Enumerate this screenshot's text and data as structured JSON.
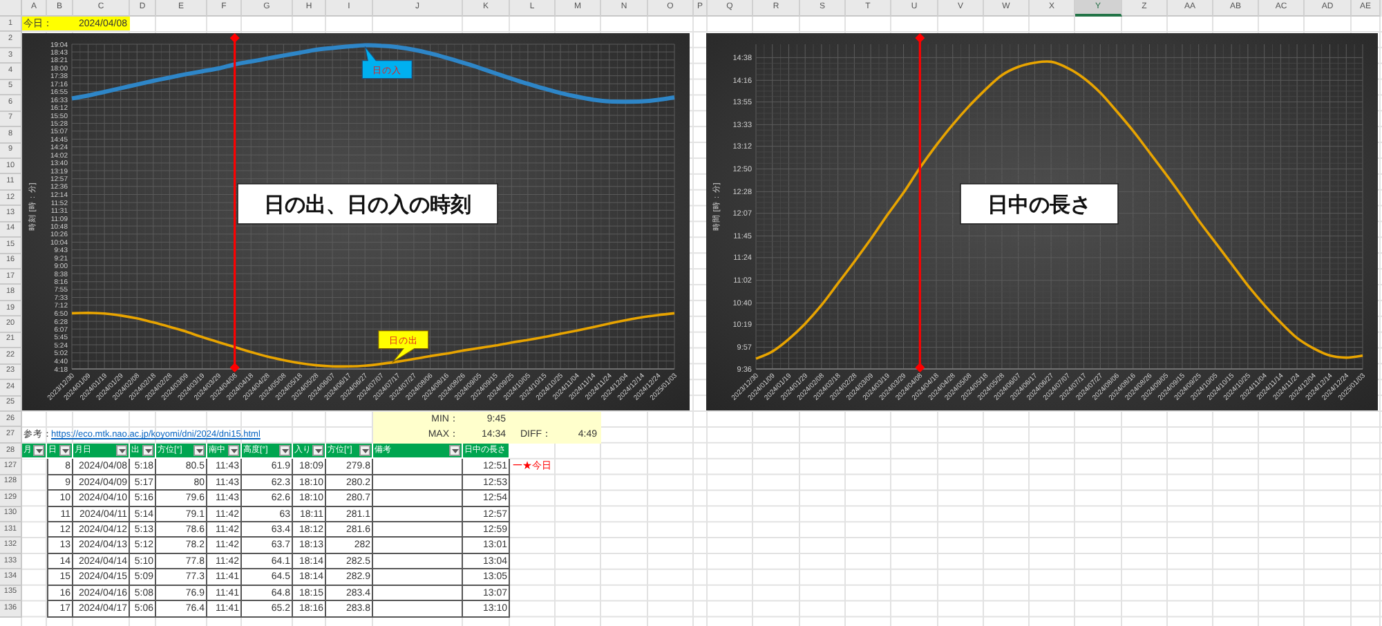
{
  "column_headers": [
    {
      "label": "A",
      "selected": false
    },
    {
      "label": "B",
      "selected": false
    },
    {
      "label": "C",
      "selected": false
    },
    {
      "label": "D",
      "selected": false
    },
    {
      "label": "E",
      "selected": false
    },
    {
      "label": "F",
      "selected": false
    },
    {
      "label": "G",
      "selected": false
    },
    {
      "label": "H",
      "selected": false
    },
    {
      "label": "I",
      "selected": false
    },
    {
      "label": "J",
      "selected": false
    },
    {
      "label": "K",
      "selected": false
    },
    {
      "label": "L",
      "selected": false
    },
    {
      "label": "M",
      "selected": false
    },
    {
      "label": "N",
      "selected": false
    },
    {
      "label": "O",
      "selected": false
    },
    {
      "label": "P",
      "selected": false
    },
    {
      "label": "Q",
      "selected": false
    },
    {
      "label": "R",
      "selected": false
    },
    {
      "label": "S",
      "selected": false
    },
    {
      "label": "T",
      "selected": false
    },
    {
      "label": "U",
      "selected": false
    },
    {
      "label": "V",
      "selected": false
    },
    {
      "label": "W",
      "selected": false
    },
    {
      "label": "X",
      "selected": false
    },
    {
      "label": "Y",
      "selected": true
    },
    {
      "label": "Z",
      "selected": false
    },
    {
      "label": "AA",
      "selected": false
    },
    {
      "label": "AB",
      "selected": false
    },
    {
      "label": "AC",
      "selected": false
    },
    {
      "label": "AD",
      "selected": false
    },
    {
      "label": "AE",
      "selected": false
    }
  ],
  "row_headers": [
    "1",
    "2",
    "3",
    "4",
    "5",
    "6",
    "7",
    "8",
    "9",
    "10",
    "11",
    "12",
    "13",
    "14",
    "15",
    "16",
    "17",
    "18",
    "19",
    "20",
    "21",
    "22",
    "23",
    "24",
    "25",
    "26",
    "27",
    "28",
    "127",
    "128",
    "129",
    "130",
    "131",
    "132",
    "133",
    "134",
    "135",
    "136"
  ],
  "today": {
    "label": "今日：",
    "date": "2024/04/08"
  },
  "charts": [
    {
      "chart_data": {
        "type": "line",
        "title": "日の出、日の入の時刻",
        "ylabel": "時刻 [時：分]",
        "categories": [
          "2023/12/30",
          "2024/01/09",
          "2024/01/19",
          "2024/01/29",
          "2024/02/08",
          "2024/02/18",
          "2024/02/28",
          "2024/03/09",
          "2024/03/19",
          "2024/03/29",
          "2024/04/08",
          "2024/04/18",
          "2024/04/28",
          "2024/05/08",
          "2024/05/18",
          "2024/05/28",
          "2024/06/07",
          "2024/06/17",
          "2024/06/27",
          "2024/07/07",
          "2024/07/17",
          "2024/07/27",
          "2024/08/06",
          "2024/08/16",
          "2024/08/26",
          "2024/09/05",
          "2024/09/15",
          "2024/09/25",
          "2024/10/05",
          "2024/10/15",
          "2024/10/25",
          "2024/11/04",
          "2024/11/14",
          "2024/11/24",
          "2024/12/04",
          "2024/12/14",
          "2024/12/24",
          "2025/01/03"
        ],
        "series": [
          {
            "name": "日の入",
            "color": "#2e86c8",
            "values": [
              996,
              1004,
              1014,
              1024,
              1034,
              1044,
              1053,
              1062,
              1070,
              1078,
              1089,
              1097,
              1105,
              1113,
              1121,
              1129,
              1134,
              1138,
              1141,
              1140,
              1136,
              1129,
              1119,
              1107,
              1094,
              1080,
              1065,
              1050,
              1036,
              1023,
              1011,
              1001,
              993,
              988,
              987,
              988,
              992,
              999
            ]
          },
          {
            "name": "日の出",
            "color": "#e8a400",
            "values": [
              410,
              411,
              409,
              404,
              396,
              385,
              373,
              360,
              345,
              331,
              318,
              304,
              292,
              282,
              274,
              268,
              265,
              265,
              267,
              272,
              278,
              285,
              293,
              300,
              308,
              315,
              322,
              330,
              337,
              345,
              354,
              363,
              372,
              382,
              391,
              399,
              405,
              410
            ]
          }
        ],
        "ylim": [
          258,
          1144
        ],
        "yticks": [
          {
            "value": 258,
            "label": "4:18"
          },
          {
            "value": 280,
            "label": "4:40"
          },
          {
            "value": 302,
            "label": "5:02"
          },
          {
            "value": 324,
            "label": "5:24"
          },
          {
            "value": 345,
            "label": "5:45"
          },
          {
            "value": 367,
            "label": "6:07"
          },
          {
            "value": 388,
            "label": "6:28"
          },
          {
            "value": 410,
            "label": "6:50"
          },
          {
            "value": 432,
            "label": "7:12"
          },
          {
            "value": 453,
            "label": "7:33"
          },
          {
            "value": 475,
            "label": "7:55"
          },
          {
            "value": 496,
            "label": "8:16"
          },
          {
            "value": 518,
            "label": "8:38"
          },
          {
            "value": 540,
            "label": "9:00"
          },
          {
            "value": 561,
            "label": "9:21"
          },
          {
            "value": 583,
            "label": "9:43"
          },
          {
            "value": 604,
            "label": "10:04"
          },
          {
            "value": 626,
            "label": "10:26"
          },
          {
            "value": 648,
            "label": "10:48"
          },
          {
            "value": 669,
            "label": "11:09"
          },
          {
            "value": 691,
            "label": "11:31"
          },
          {
            "value": 712,
            "label": "11:52"
          },
          {
            "value": 734,
            "label": "12:14"
          },
          {
            "value": 756,
            "label": "12:36"
          },
          {
            "value": 777,
            "label": "12:57"
          },
          {
            "value": 799,
            "label": "13:19"
          },
          {
            "value": 820,
            "label": "13:40"
          },
          {
            "value": 842,
            "label": "14:02"
          },
          {
            "value": 864,
            "label": "14:24"
          },
          {
            "value": 885,
            "label": "14:45"
          },
          {
            "value": 907,
            "label": "15:07"
          },
          {
            "value": 928,
            "label": "15:28"
          },
          {
            "value": 950,
            "label": "15:50"
          },
          {
            "value": 972,
            "label": "16:12"
          },
          {
            "value": 993,
            "label": "16:33"
          },
          {
            "value": 1015,
            "label": "16:55"
          },
          {
            "value": 1036,
            "label": "17:16"
          },
          {
            "value": 1058,
            "label": "17:38"
          },
          {
            "value": 1080,
            "label": "18:00"
          },
          {
            "value": 1101,
            "label": "18:21"
          },
          {
            "value": 1123,
            "label": "18:43"
          },
          {
            "value": 1144,
            "label": "19:04"
          }
        ],
        "grid": true,
        "ref_lines": [
          {
            "axis": "x",
            "value": "2024/04/08",
            "color": "#ff0000"
          }
        ]
      }
    },
    {
      "chart_data": {
        "type": "line",
        "title": "日中の長さ",
        "ylabel": "時間 [時：分]",
        "categories": [
          "2023/12/30",
          "2024/01/09",
          "2024/01/19",
          "2024/01/29",
          "2024/02/08",
          "2024/02/18",
          "2024/02/28",
          "2024/03/09",
          "2024/03/19",
          "2024/03/29",
          "2024/04/08",
          "2024/04/18",
          "2024/04/28",
          "2024/05/08",
          "2024/05/18",
          "2024/05/28",
          "2024/06/07",
          "2024/06/17",
          "2024/06/27",
          "2024/07/07",
          "2024/07/17",
          "2024/07/27",
          "2024/08/06",
          "2024/08/16",
          "2024/08/26",
          "2024/09/05",
          "2024/09/15",
          "2024/09/25",
          "2024/10/05",
          "2024/10/15",
          "2024/10/25",
          "2024/11/04",
          "2024/11/14",
          "2024/11/24",
          "2024/12/04",
          "2024/12/14",
          "2024/12/24",
          "2025/01/03"
        ],
        "series": [
          {
            "color": "#e8a400",
            "values": [
              586,
              593,
              605,
              620,
              638,
              659,
              680,
              702,
              725,
              747,
              771,
              793,
              813,
              831,
              847,
              861,
              869,
              873,
              874,
              868,
              858,
              844,
              826,
              807,
              786,
              765,
              743,
              720,
              699,
              678,
              657,
              638,
              621,
              606,
              596,
              589,
              587,
              589
            ]
          }
        ],
        "ylim": [
          576,
          891
        ],
        "yticks": [
          {
            "value": 576,
            "label": "9:36"
          },
          {
            "value": 597,
            "label": "9:57"
          },
          {
            "value": 619,
            "label": "10:19"
          },
          {
            "value": 640,
            "label": "10:40"
          },
          {
            "value": 662,
            "label": "11:02"
          },
          {
            "value": 684,
            "label": "11:24"
          },
          {
            "value": 705,
            "label": "11:45"
          },
          {
            "value": 727,
            "label": "12:07"
          },
          {
            "value": 748,
            "label": "12:28"
          },
          {
            "value": 770,
            "label": "12:50"
          },
          {
            "value": 792,
            "label": "13:12"
          },
          {
            "value": 813,
            "label": "13:33"
          },
          {
            "value": 835,
            "label": "13:55"
          },
          {
            "value": 856,
            "label": "14:16"
          },
          {
            "value": 878,
            "label": "14:38"
          }
        ],
        "grid": true,
        "ref_lines": [
          {
            "axis": "x",
            "value": "2024/04/08",
            "color": "#ff0000"
          }
        ]
      }
    }
  ],
  "summary": {
    "min_label": "MIN：",
    "min": "9:45",
    "max_label": "MAX：",
    "max": "14:34",
    "diff_label": "DIFF：",
    "diff": "4:49"
  },
  "reference": {
    "label": "参考：",
    "link": "https://eco.mtk.nao.ac.jp/koyomi/dni/2024/dni15.html"
  },
  "table": {
    "columns": [
      {
        "label": "月",
        "filter": true
      },
      {
        "label": "日",
        "filter": true
      },
      {
        "label": "月日",
        "filter": true
      },
      {
        "label": "出",
        "filter": true
      },
      {
        "label": "方位[°]",
        "filter": true
      },
      {
        "label": "南中",
        "filter": true
      },
      {
        "label": "高度[°]",
        "filter": true
      },
      {
        "label": "入り",
        "filter": true
      },
      {
        "label": "方位[°]",
        "filter": true
      },
      {
        "label": "備考",
        "filter": true
      },
      {
        "label": "日中の長さ",
        "filter": false
      }
    ],
    "rows": [
      {
        "day": "8",
        "date": "2024/04/08",
        "sunrise": "5:18",
        "rise_azimuth": "80.5",
        "transit": "11:43",
        "altitude": "61.9",
        "sunset": "18:09",
        "set_azimuth": "279.8",
        "day_length": "12:51",
        "marker": "一★今日"
      },
      {
        "day": "9",
        "date": "2024/04/09",
        "sunrise": "5:17",
        "rise_azimuth": "80",
        "transit": "11:43",
        "altitude": "62.3",
        "sunset": "18:10",
        "set_azimuth": "280.2",
        "day_length": "12:53"
      },
      {
        "day": "10",
        "date": "2024/04/10",
        "sunrise": "5:16",
        "rise_azimuth": "79.6",
        "transit": "11:43",
        "altitude": "62.6",
        "sunset": "18:10",
        "set_azimuth": "280.7",
        "day_length": "12:54"
      },
      {
        "day": "11",
        "date": "2024/04/11",
        "sunrise": "5:14",
        "rise_azimuth": "79.1",
        "transit": "11:42",
        "altitude": "63",
        "sunset": "18:11",
        "set_azimuth": "281.1",
        "day_length": "12:57"
      },
      {
        "day": "12",
        "date": "2024/04/12",
        "sunrise": "5:13",
        "rise_azimuth": "78.6",
        "transit": "11:42",
        "altitude": "63.4",
        "sunset": "18:12",
        "set_azimuth": "281.6",
        "day_length": "12:59"
      },
      {
        "day": "13",
        "date": "2024/04/13",
        "sunrise": "5:12",
        "rise_azimuth": "78.2",
        "transit": "11:42",
        "altitude": "63.7",
        "sunset": "18:13",
        "set_azimuth": "282",
        "day_length": "13:01"
      },
      {
        "day": "14",
        "date": "2024/04/14",
        "sunrise": "5:10",
        "rise_azimuth": "77.8",
        "transit": "11:42",
        "altitude": "64.1",
        "sunset": "18:14",
        "set_azimuth": "282.5",
        "day_length": "13:04"
      },
      {
        "day": "15",
        "date": "2024/04/15",
        "sunrise": "5:09",
        "rise_azimuth": "77.3",
        "transit": "11:41",
        "altitude": "64.5",
        "sunset": "18:14",
        "set_azimuth": "282.9",
        "day_length": "13:05"
      },
      {
        "day": "16",
        "date": "2024/04/16",
        "sunrise": "5:08",
        "rise_azimuth": "76.9",
        "transit": "11:41",
        "altitude": "64.8",
        "sunset": "18:15",
        "set_azimuth": "283.4",
        "day_length": "13:07"
      },
      {
        "day": "17",
        "date": "2024/04/17",
        "sunrise": "5:06",
        "rise_azimuth": "76.4",
        "transit": "11:41",
        "altitude": "65.2",
        "sunset": "18:16",
        "set_azimuth": "283.8",
        "day_length": "13:10"
      }
    ]
  }
}
